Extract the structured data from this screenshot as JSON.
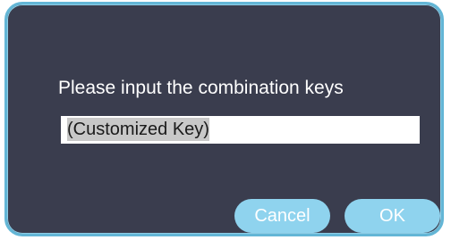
{
  "dialog": {
    "prompt": "Please input the combination keys",
    "input_value": "(Customized Key)",
    "cancel_label": "Cancel",
    "ok_label": "OK"
  },
  "colors": {
    "dialog_background": "#3a3d4e",
    "dialog_border": "#63b6d6",
    "button_background": "#8fd3ee",
    "text": "#ffffff"
  }
}
